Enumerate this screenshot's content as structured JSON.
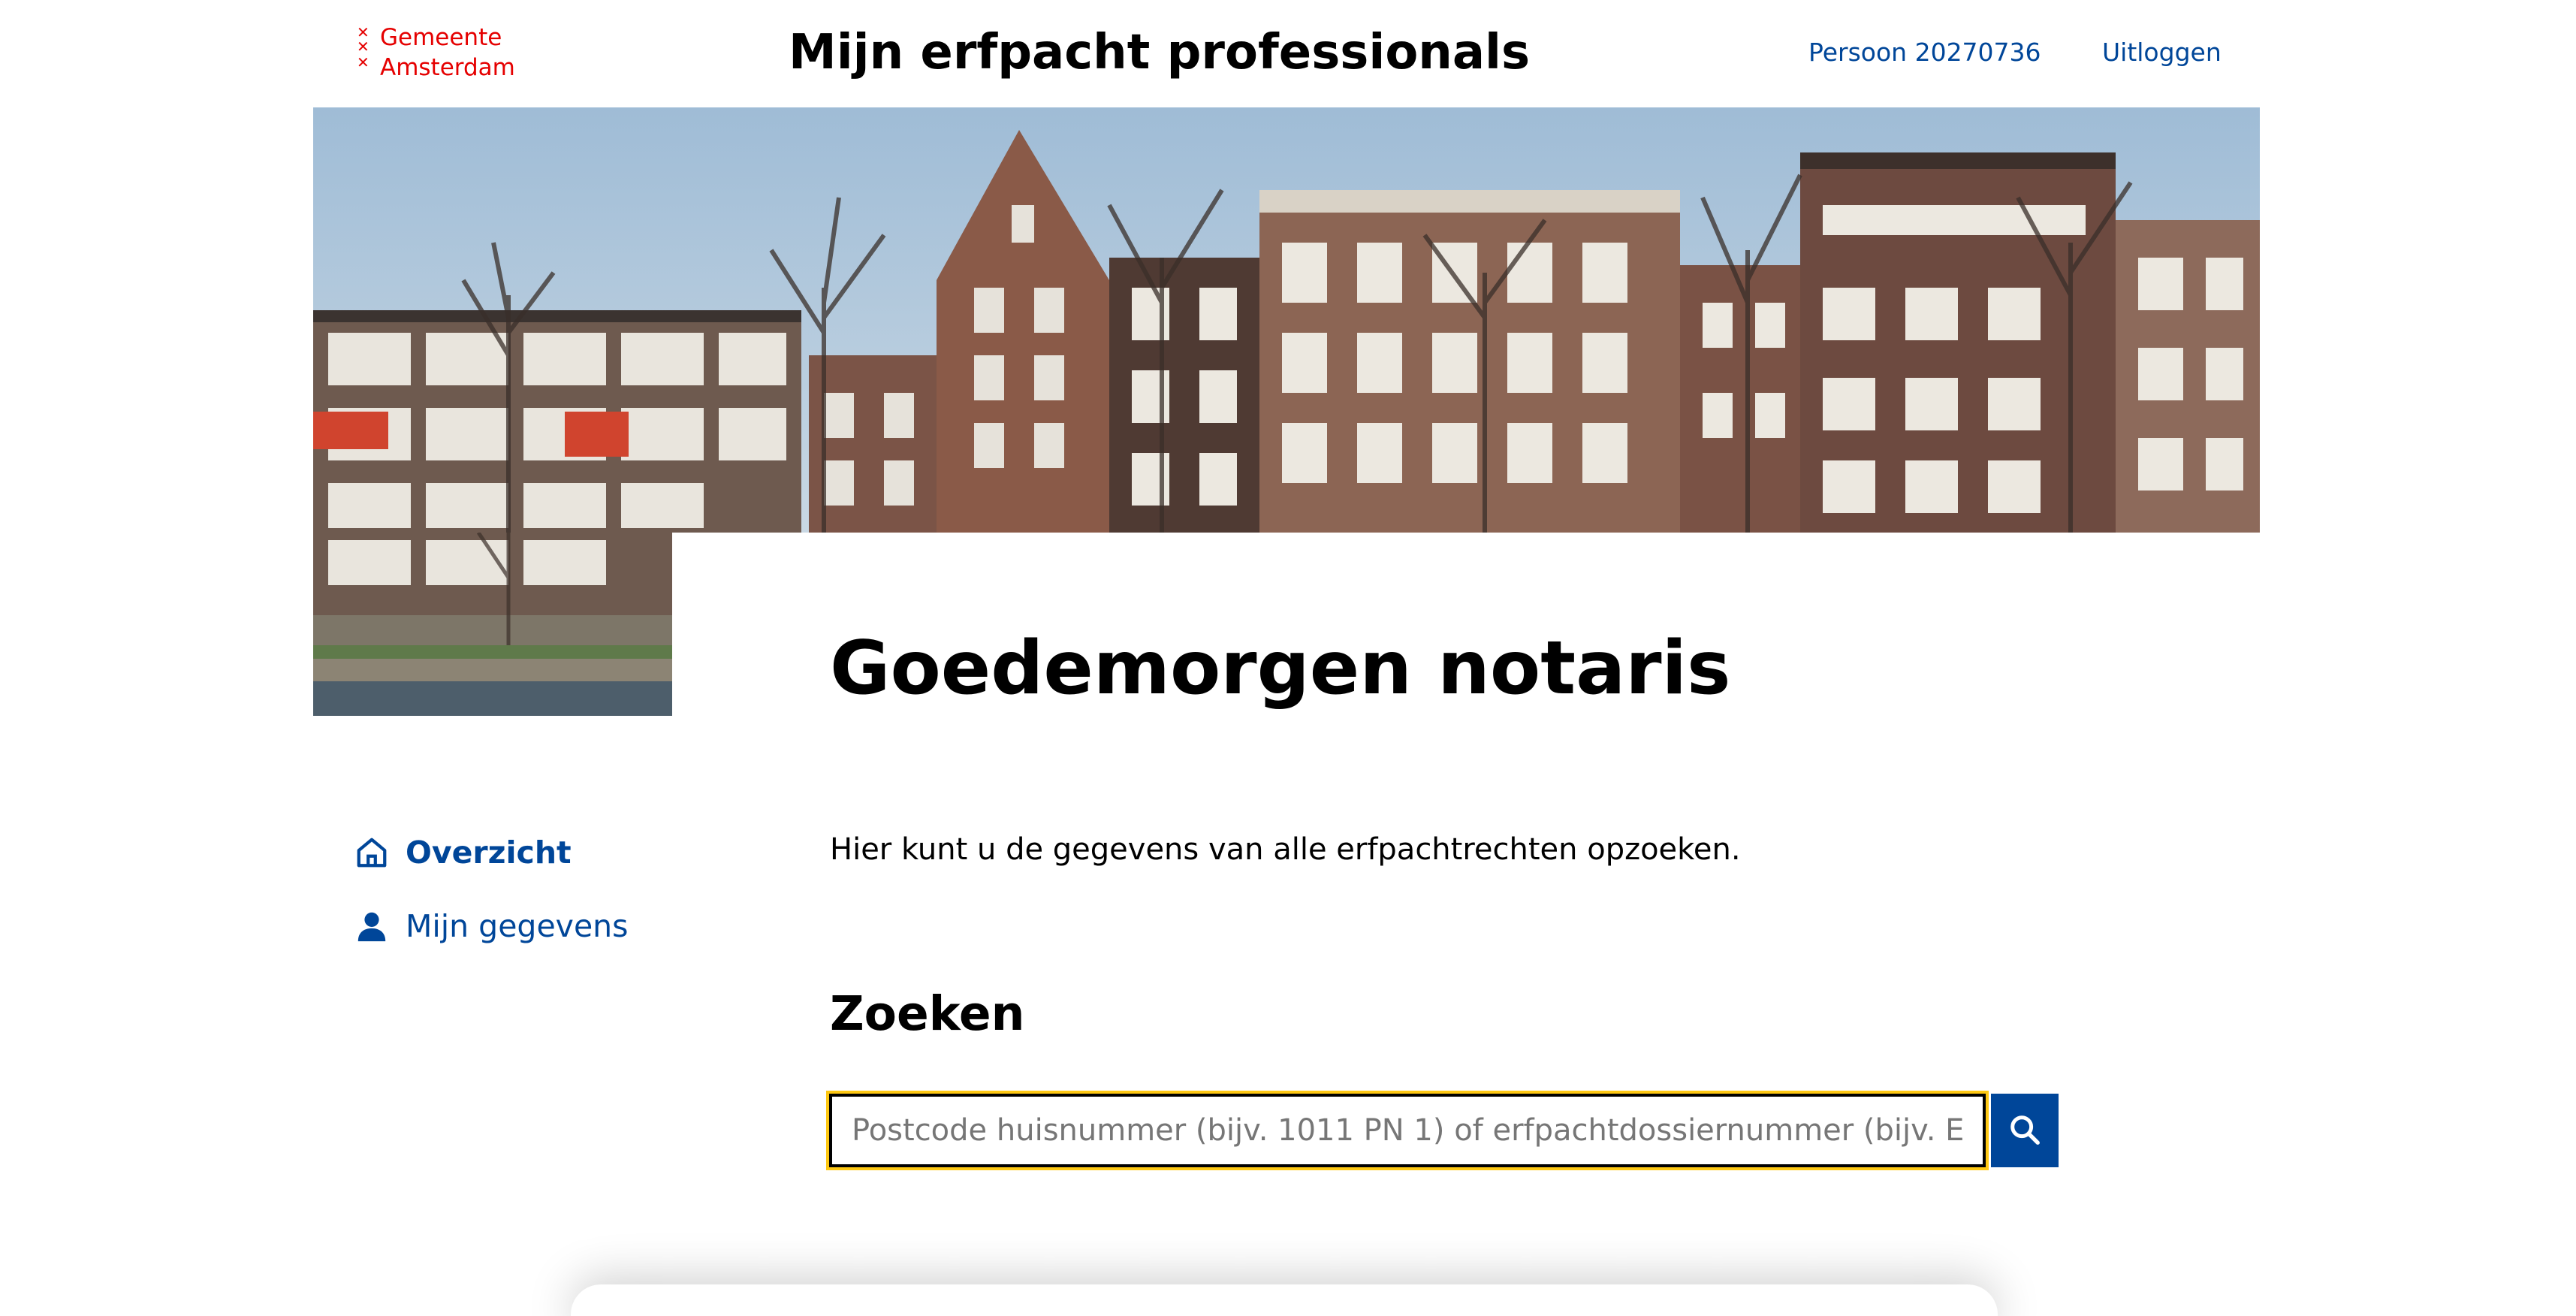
{
  "header": {
    "logo_line1": "Gemeente",
    "logo_line2": "Amsterdam",
    "app_title": "Mijn erfpacht professionals",
    "user_link": "Persoon 20270736",
    "logout_link": "Uitloggen"
  },
  "hero": {
    "image_name": "hero-image",
    "description_icon": "amsterdam-canal-houses-photo"
  },
  "main": {
    "greeting": "Goedemorgen notaris",
    "intro": "Hier kunt u de gegevens van alle erfpachtrechten opzoeken.",
    "search_heading": "Zoeken",
    "search_placeholder": "Postcode huisnummer (bijv. 1011 PN 1) of erfpachtdossiernummer (bijv. E",
    "search_value": "",
    "search_button_icon": "search-icon"
  },
  "sidebar": {
    "items": [
      {
        "label": "Overzicht",
        "icon": "home-icon",
        "active": true
      },
      {
        "label": "Mijn gegevens",
        "icon": "user-icon",
        "active": false
      }
    ]
  },
  "colors": {
    "brand_red": "#e50000",
    "link_blue": "#004699",
    "focus_yellow": "#fec813",
    "text": "#000000"
  }
}
